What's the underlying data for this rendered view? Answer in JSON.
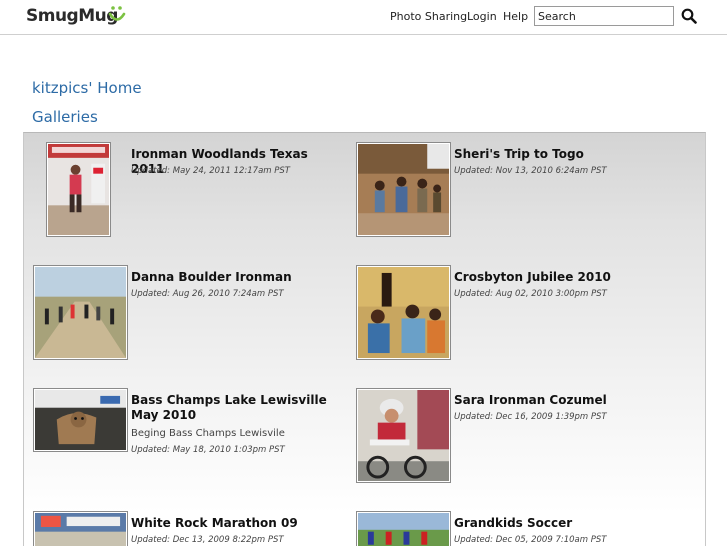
{
  "header": {
    "logo_text": "SmugMug",
    "nav": {
      "photo_sharing": "Photo Sharing",
      "login": "Login",
      "help": "Help"
    },
    "search": {
      "value": "Search",
      "icon": "search-icon"
    }
  },
  "page": {
    "home_link": "kitzpics' Home",
    "section_title": "Galleries"
  },
  "colors": {
    "link_blue": "#2d6ba6",
    "logo_green": "#7cc242"
  },
  "galleries": [
    {
      "title": "Ironman Woodlands Texas 2011",
      "description": "",
      "updated": "Updated: May 24, 2011 12:17am PST"
    },
    {
      "title": "Sheri's Trip to Togo",
      "description": "",
      "updated": "Updated: Nov 13, 2010 6:24am PST"
    },
    {
      "title": "Danna Boulder Ironman",
      "description": "",
      "updated": "Updated: Aug 26, 2010 7:24am PST"
    },
    {
      "title": "Crosbyton Jubilee 2010",
      "description": "",
      "updated": "Updated: Aug 02, 2010 3:00pm PST"
    },
    {
      "title": "Bass Champs Lake Lewisville May 2010",
      "description": "Beging Bass Champs Lewisvile",
      "updated": "Updated: May 18, 2010 1:03pm PST"
    },
    {
      "title": "Sara Ironman Cozumel",
      "description": "",
      "updated": "Updated: Dec 16, 2009 1:39pm PST"
    },
    {
      "title": "White Rock Marathon 09",
      "description": "",
      "updated": "Updated: Dec 13, 2009 8:22pm PST"
    },
    {
      "title": "Grandkids Soccer",
      "description": "",
      "updated": "Updated: Dec 05, 2009 7:10am PST"
    }
  ]
}
